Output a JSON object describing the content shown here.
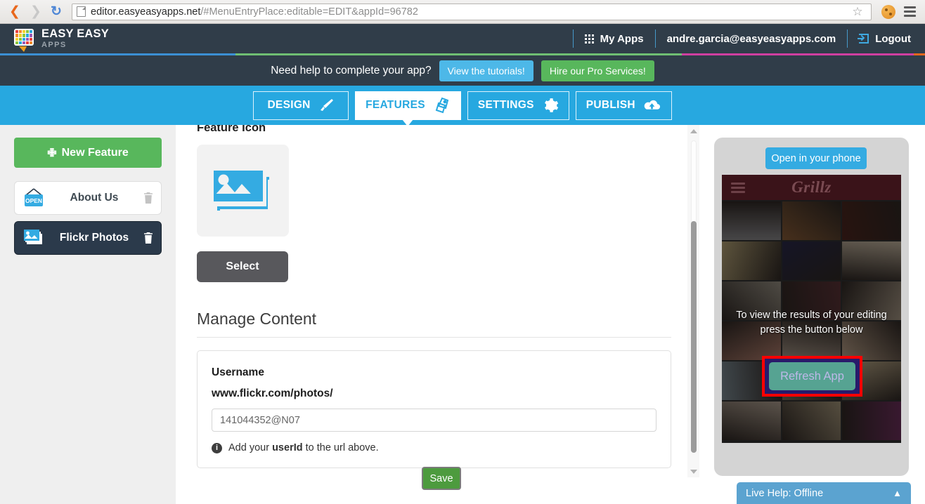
{
  "browser": {
    "back_icon": "back-arrow-icon",
    "forward_icon": "forward-arrow-icon",
    "reload_icon": "reload-icon",
    "url_host": "editor.easyeasyapps.net",
    "url_rest": "/#MenuEntryPlace:editable=EDIT&appId=96782",
    "url_full": "editor.easyeasyapps.net/#MenuEntryPlace:editable=EDIT&appId=96782",
    "star_icon": "bookmark-star-icon",
    "cookie_icon": "cookie-icon",
    "menu_icon": "hamburger-menu-icon"
  },
  "header": {
    "logo_title": "EASY EASY",
    "logo_sub": "APPS",
    "grid_icon": "apps-grid-icon",
    "my_apps": "My Apps",
    "account_email": "andre.garcia@easyeasyapps.com",
    "logout_icon": "logout-icon",
    "logout": "Logout",
    "accent_colors": [
      "#3b8fd4",
      "#6fbf73",
      "#8bc34a",
      "#cf3fa0",
      "#e8671c"
    ]
  },
  "promo": {
    "message": "Need help to complete your app?",
    "tutorials_btn": "View the tutorials!",
    "pro_btn": "Hire our Pro Services!",
    "tutorials_color": "#4db8e8",
    "pro_color": "#58b75c"
  },
  "tabs": [
    {
      "label": "DESIGN",
      "icon": "paintbrush-icon",
      "active": false
    },
    {
      "label": "FEATURES",
      "icon": "tags-icon",
      "active": true
    },
    {
      "label": "SETTINGS",
      "icon": "gear-icon",
      "active": false
    },
    {
      "label": "PUBLISH",
      "icon": "cloud-upload-icon",
      "active": false
    }
  ],
  "sidebar": {
    "new_feature_label": "New Feature",
    "new_feature_icon": "plus-icon",
    "items": [
      {
        "label": "About Us",
        "icon": "open-sign-icon",
        "selected": false,
        "delete_icon": "trash-icon"
      },
      {
        "label": "Flickr Photos",
        "icon": "photo-stack-icon",
        "selected": true,
        "delete_icon": "trash-icon"
      }
    ]
  },
  "main": {
    "feature_icon_label": "Feature Icon",
    "feature_icon_name": "photo-stack-icon",
    "select_button": "Select",
    "manage_content_title": "Manage Content",
    "field_label": "Username",
    "field_url": "www.flickr.com/photos/",
    "input_value": "141044352@N07",
    "input_placeholder": "141044352@N07",
    "hint_prefix": "Add your",
    "hint_bold": "userId",
    "hint_suffix": "to the url above.",
    "save_button": "Save"
  },
  "preview": {
    "open_in_phone": "Open in your phone",
    "app_brand": "Grillz",
    "menu_icon": "hamburger-menu-icon",
    "overlay_line1": "To view the results of your editing",
    "overlay_line2": "press the button below",
    "refresh_button": "Refresh App",
    "highlight_color": "#ff0000",
    "refresh_color": "#56a392",
    "photo_colors": [
      "#8b8b8e",
      "#8a5c33",
      "#4a2118",
      "#b9a878",
      "#232448",
      "#c9bba4",
      "#9a9486",
      "#5a2f33",
      "#a89a86",
      "#b9826f",
      "#b0a08f",
      "#c3a98e",
      "#7d8e97",
      "#9a8a6e",
      "#c7b58f",
      "#b5a695",
      "#a89a7c",
      "#6d2b5c"
    ]
  },
  "live_help": {
    "label": "Live Help: Offline",
    "chevron_icon": "chevron-up-icon"
  },
  "scrollbar": {
    "up_icon": "scroll-up-arrow-icon",
    "down_icon": "scroll-down-arrow-icon"
  }
}
